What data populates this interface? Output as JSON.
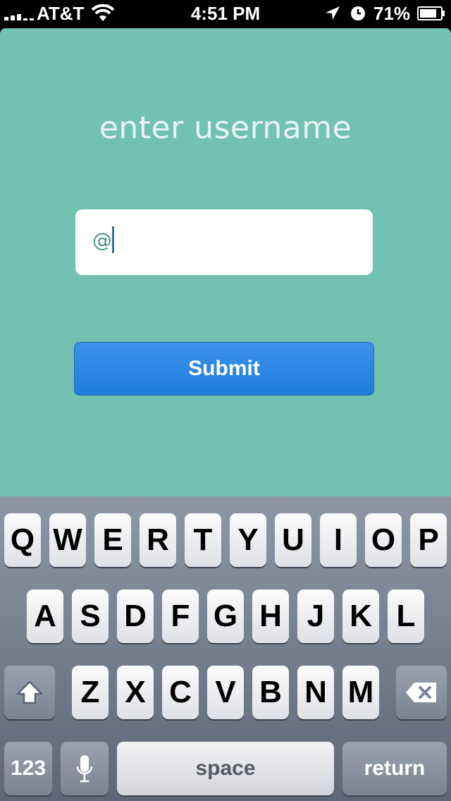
{
  "status_bar": {
    "carrier": "AT&T",
    "time": "4:51 PM",
    "battery": "71%"
  },
  "screen": {
    "title": "enter username",
    "username_field": {
      "value": "@"
    },
    "submit_label": "Submit"
  },
  "keyboard": {
    "row1": [
      "Q",
      "W",
      "E",
      "R",
      "T",
      "Y",
      "U",
      "I",
      "O",
      "P"
    ],
    "row2": [
      "A",
      "S",
      "D",
      "F",
      "G",
      "H",
      "J",
      "K",
      "L"
    ],
    "row3": [
      "Z",
      "X",
      "C",
      "V",
      "B",
      "N",
      "M"
    ],
    "numbers_label": "123",
    "space_label": "space",
    "return_label": "return"
  }
}
